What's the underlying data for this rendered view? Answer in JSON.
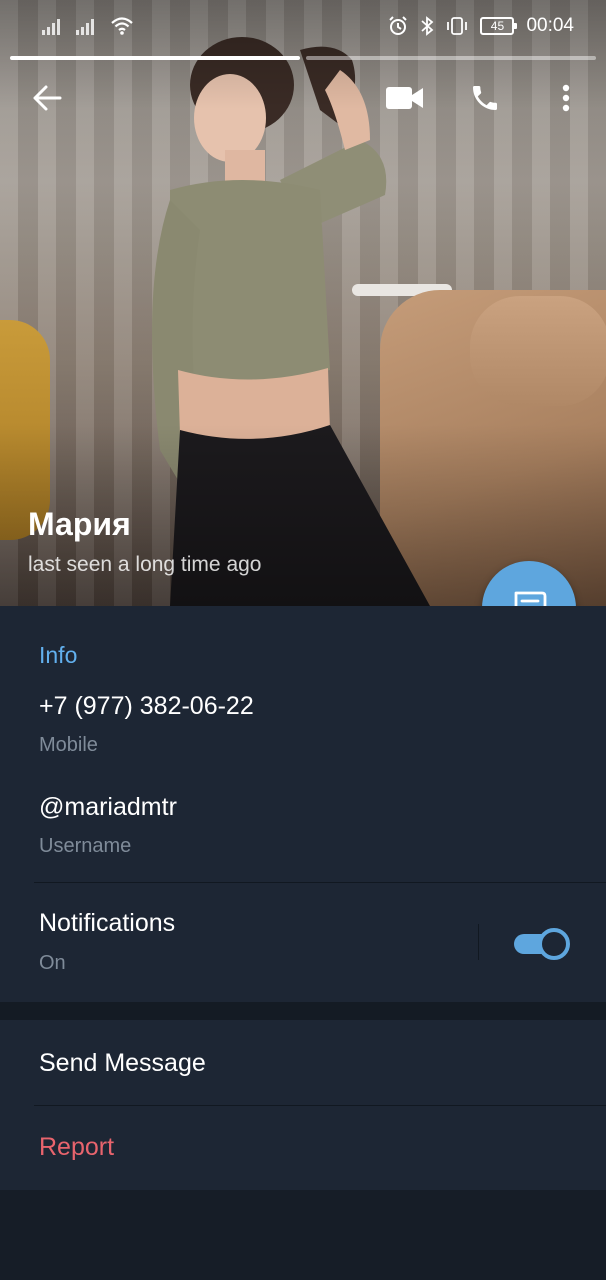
{
  "status_bar": {
    "time": "00:04",
    "battery": "45",
    "icons": [
      "signal-icon",
      "signal-icon",
      "wifi-icon",
      "alarm-icon",
      "bluetooth-icon",
      "vibrate-icon",
      "battery-icon"
    ]
  },
  "stories": {
    "count": 2,
    "active_index": 0
  },
  "toolbar": {
    "icons": [
      "back-arrow-icon",
      "video-call-icon",
      "phone-icon",
      "more-vert-icon"
    ]
  },
  "profile": {
    "name": "Мария",
    "status": "last seen a long time ago"
  },
  "info": {
    "title": "Info",
    "phone": {
      "value": "+7 (977) 382-06-22",
      "label": "Mobile"
    },
    "username": {
      "value": "@mariadmtr",
      "label": "Username"
    },
    "notifications": {
      "value": "Notifications",
      "label": "On",
      "enabled": true
    }
  },
  "actions": {
    "send_message": "Send Message",
    "report": "Report"
  },
  "colors": {
    "accent": "#5ea6de",
    "link": "#62b0ee",
    "danger": "#e8646d",
    "panel": "#1d2634",
    "background": "#161d27",
    "secondary_text": "#7f8b99"
  }
}
